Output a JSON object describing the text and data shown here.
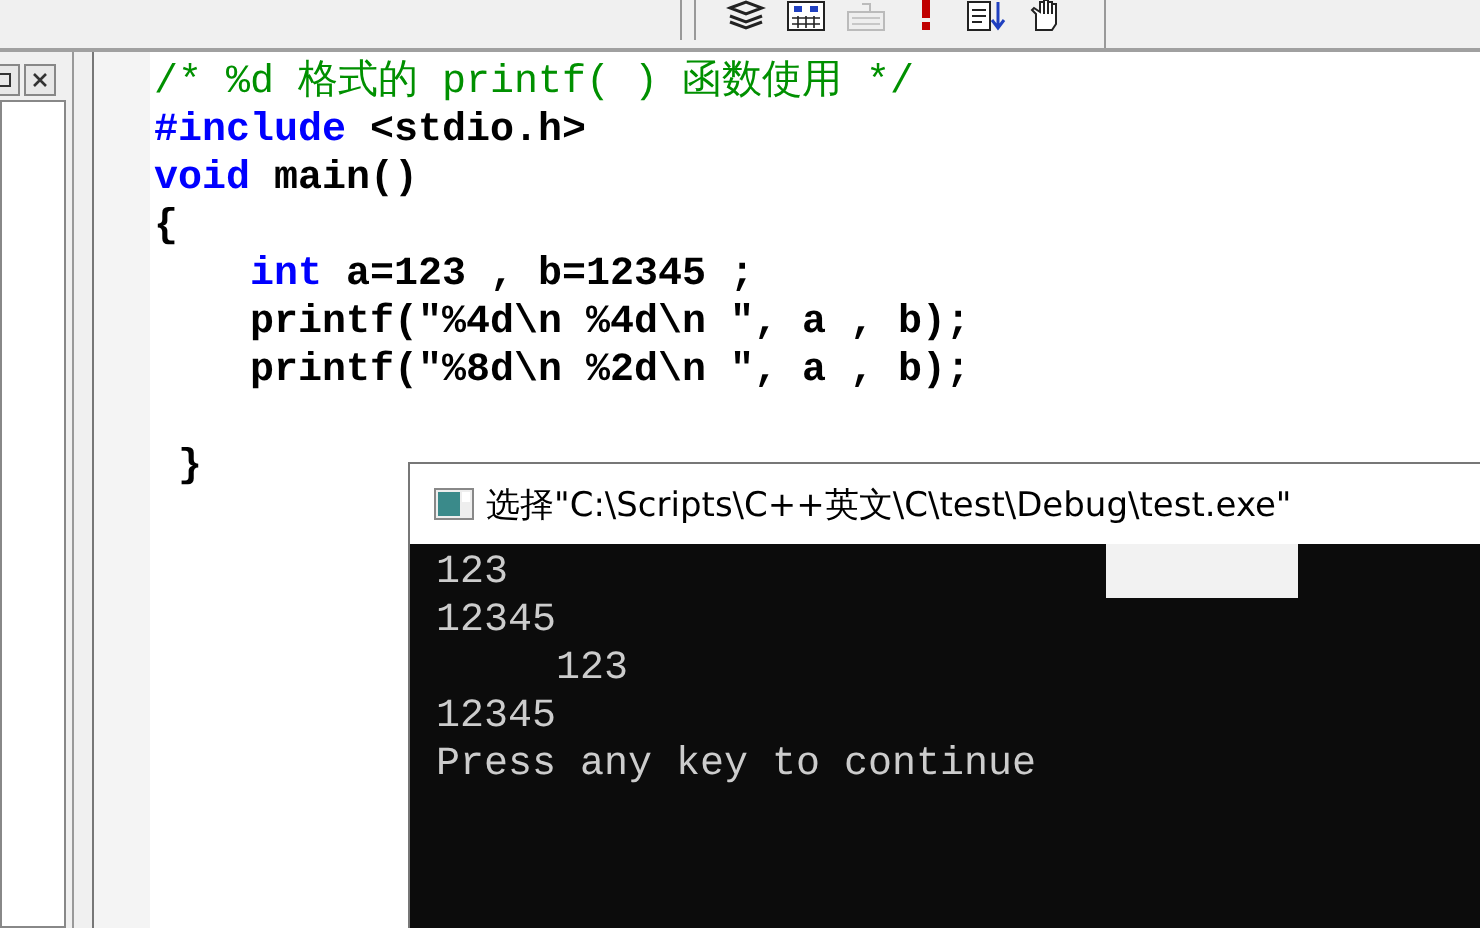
{
  "toolbar": {
    "buttons": [
      {
        "kind": "stack",
        "disabled": false
      },
      {
        "kind": "grid",
        "disabled": false
      },
      {
        "kind": "keyboard",
        "disabled": true
      },
      {
        "kind": "exclaim",
        "disabled": false
      },
      {
        "kind": "sort",
        "disabled": false
      },
      {
        "kind": "hand",
        "disabled": false
      }
    ]
  },
  "editor": {
    "lines": [
      {
        "kind": "code",
        "indented": false,
        "tokens": [
          {
            "kind": "comment",
            "text": "/* %d 格式的 printf( ) 函数使用 */"
          }
        ]
      },
      {
        "kind": "code",
        "indented": false,
        "tokens": [
          {
            "kind": "keyword",
            "text": "#include"
          },
          {
            "kind": "plain",
            "text": " <stdio.h>"
          }
        ]
      },
      {
        "kind": "code",
        "indented": false,
        "tokens": [
          {
            "kind": "keyword",
            "text": "void"
          },
          {
            "kind": "plain",
            "text": " main()"
          }
        ]
      },
      {
        "kind": "code",
        "indented": false,
        "tokens": [
          {
            "kind": "plain",
            "text": "{"
          }
        ]
      },
      {
        "kind": "code",
        "indented": true,
        "tokens": [
          {
            "kind": "keyword",
            "text": "int"
          },
          {
            "kind": "plain",
            "text": " a=123 , b=12345 ;"
          }
        ]
      },
      {
        "kind": "code",
        "indented": true,
        "tokens": [
          {
            "kind": "plain",
            "text": "printf(\"%4d\\n %4d\\n \", a , b);"
          }
        ]
      },
      {
        "kind": "code",
        "indented": true,
        "tokens": [
          {
            "kind": "plain",
            "text": "printf(\"%8d\\n %2d\\n \", a , b);"
          }
        ]
      },
      {
        "kind": "blank"
      },
      {
        "kind": "code",
        "indented": false,
        "tokens": [
          {
            "kind": "plain",
            "text": " }"
          }
        ]
      }
    ]
  },
  "console": {
    "title": "选择\"C:\\Scripts\\C++英文\\C\\test\\Debug\\test.exe\"",
    "lines": [
      "123",
      "12345",
      "     123",
      "12345",
      "Press any key to continue"
    ]
  }
}
